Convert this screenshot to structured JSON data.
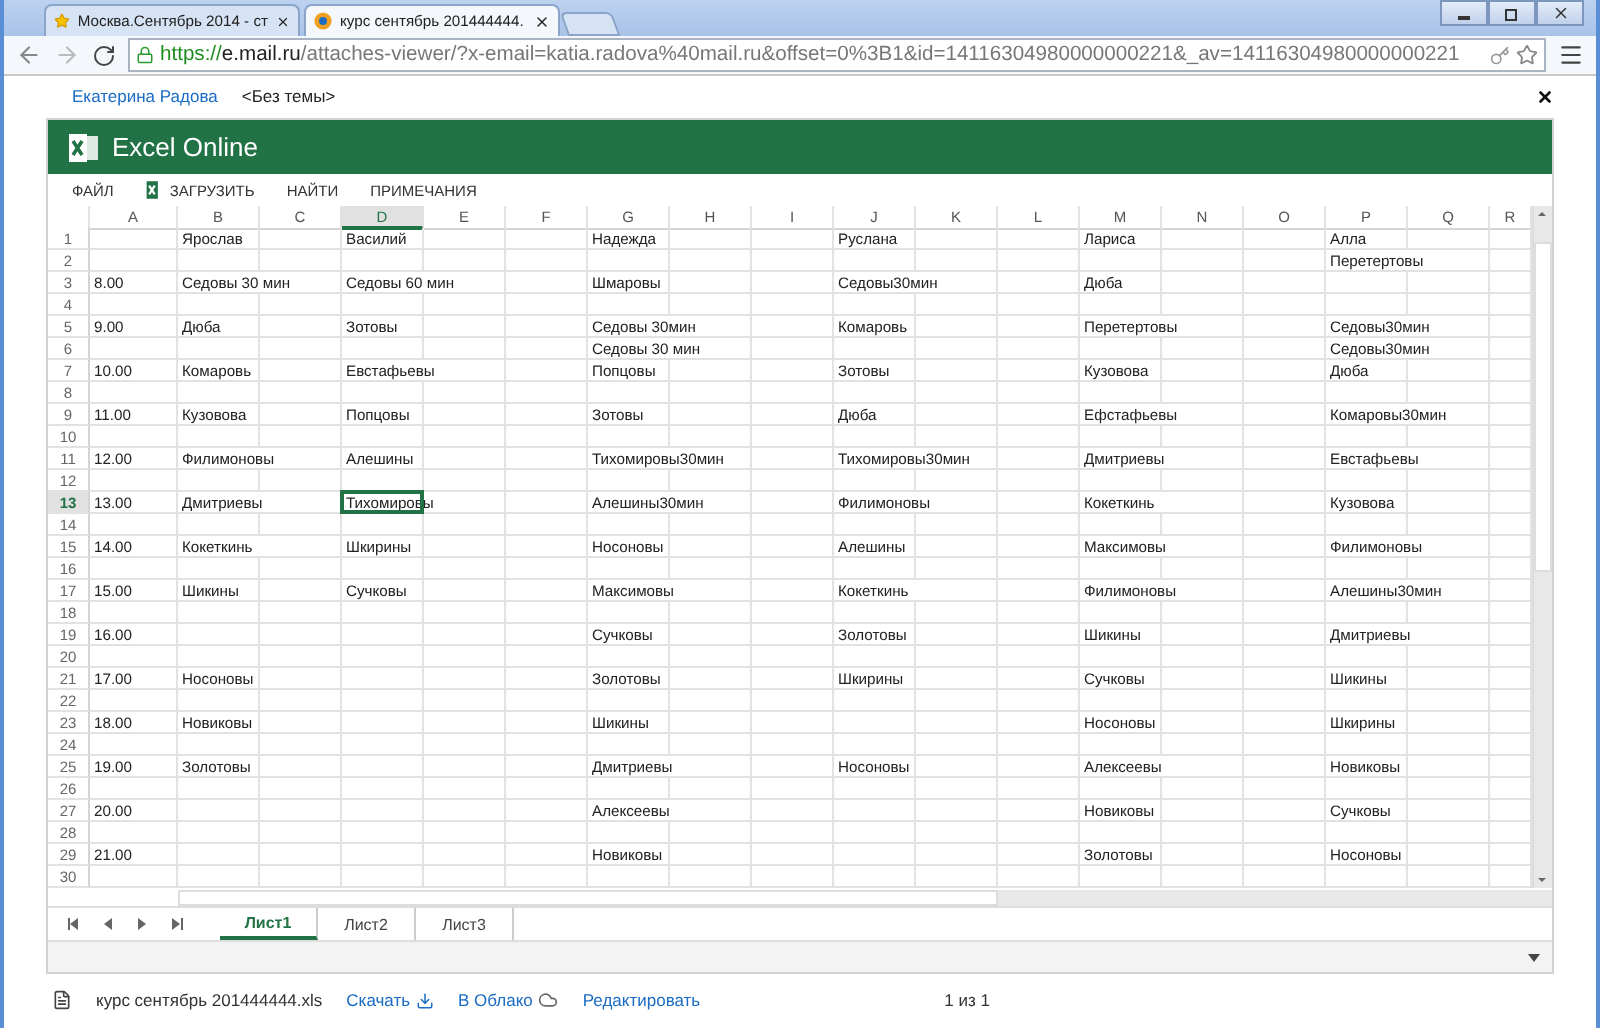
{
  "browser": {
    "tabs": [
      {
        "title": "Москва.Сентябрь 2014 - ст",
        "selected": false
      },
      {
        "title": "курс сентябрь 201444444.",
        "selected": true
      }
    ],
    "url": {
      "scheme": "https://",
      "host": "e.mail.ru",
      "path": "/attaches-viewer/?x-email=katia.radova%40mail.ru&offset=0%3B1&id=14116304980000000221&_av=14116304980000000221"
    }
  },
  "message": {
    "sender": "Екатерина Радова",
    "subject": "<Без темы>"
  },
  "app": {
    "title": "Excel Online",
    "menu": [
      {
        "label": "ФАЙЛ",
        "kind": "text"
      },
      {
        "label": "ЗАГРУЗИТЬ",
        "kind": "excel"
      },
      {
        "label": "НАЙТИ",
        "kind": "text"
      },
      {
        "label": "ПРИМЕЧАНИЯ",
        "kind": "text"
      }
    ]
  },
  "grid": {
    "columns": [
      {
        "label": "A",
        "selected": false
      },
      {
        "label": "B",
        "selected": false
      },
      {
        "label": "C",
        "selected": false
      },
      {
        "label": "D",
        "selected": true
      },
      {
        "label": "E",
        "selected": false
      },
      {
        "label": "F",
        "selected": false
      },
      {
        "label": "G",
        "selected": false
      },
      {
        "label": "H",
        "selected": false
      },
      {
        "label": "I",
        "selected": false
      },
      {
        "label": "J",
        "selected": false
      },
      {
        "label": "K",
        "selected": false
      },
      {
        "label": "L",
        "selected": false
      },
      {
        "label": "M",
        "selected": false
      },
      {
        "label": "N",
        "selected": false
      },
      {
        "label": "O",
        "selected": false
      },
      {
        "label": "P",
        "selected": false
      },
      {
        "label": "Q",
        "selected": false
      },
      {
        "label": "R",
        "selected": false
      }
    ],
    "rows": [
      {
        "number": "1",
        "selected": false,
        "cells": {
          "B": "Ярослав",
          "D": "Василий",
          "G": "Надежда",
          "J": "Руслана",
          "M": "Лариса",
          "P": "Алла"
        }
      },
      {
        "number": "2",
        "selected": false,
        "cells": {
          "P": "Перетертовы"
        }
      },
      {
        "number": "3",
        "selected": false,
        "cells": {
          "A": "8.00",
          "B": "Седовы 30 мин",
          "D": "Седовы 60 мин",
          "G": "Шмаровы",
          "J": "Седовы30мин",
          "M": "Дюба"
        }
      },
      {
        "number": "4",
        "selected": false,
        "cells": {}
      },
      {
        "number": "5",
        "selected": false,
        "cells": {
          "A": "9.00",
          "B": "Дюба",
          "D": "Зотовы",
          "G": "Седовы 30мин",
          "J": "Комаровь",
          "M": "Перетертовы",
          "P": "Седовы30мин"
        }
      },
      {
        "number": "6",
        "selected": false,
        "cells": {
          "G": "Седовы 30 мин",
          "P": "Седовы30мин"
        }
      },
      {
        "number": "7",
        "selected": false,
        "cells": {
          "A": "10.00",
          "B": "Комаровь",
          "D": "Евстафьевы",
          "G": "Попцовы",
          "J": "Зотовы",
          "M": "Кузовова",
          "P": "Дюба"
        }
      },
      {
        "number": "8",
        "selected": false,
        "cells": {}
      },
      {
        "number": "9",
        "selected": false,
        "cells": {
          "A": "11.00",
          "B": "Кузовова",
          "D": "Попцовы",
          "G": "Зотовы",
          "J": "Дюба",
          "M": "Ефстафьевы",
          "P": "Комаровы30мин"
        }
      },
      {
        "number": "10",
        "selected": false,
        "cells": {}
      },
      {
        "number": "11",
        "selected": false,
        "cells": {
          "A": "12.00",
          "B": "Филимоновы",
          "D": "Алешины",
          "G": "Тихомировы30мин",
          "J": "Тихомировы30мин",
          "M": "Дмитриевы",
          "P": "Евстафьевы"
        }
      },
      {
        "number": "12",
        "selected": false,
        "cells": {}
      },
      {
        "number": "13",
        "selected": true,
        "cells": {
          "A": "13.00",
          "B": "Дмитриевы",
          "D": "Тихомировы",
          "G": "Алешины30мин",
          "J": "Филимоновы",
          "M": "Кокеткинь",
          "P": "Кузовова"
        }
      },
      {
        "number": "14",
        "selected": false,
        "cells": {}
      },
      {
        "number": "15",
        "selected": false,
        "cells": {
          "A": "14.00",
          "B": "Кокеткинь",
          "D": "Шкирины",
          "G": "Носоновы",
          "J": "Алешины",
          "M": "Максимовы",
          "P": "Филимоновы"
        }
      },
      {
        "number": "16",
        "selected": false,
        "cells": {}
      },
      {
        "number": "17",
        "selected": false,
        "cells": {
          "A": "15.00",
          "B": "Шикины",
          "D": "Сучковы",
          "G": "Максимовы",
          "J": "Кокеткинь",
          "M": "Филимоновы",
          "P": "Алешины30мин"
        }
      },
      {
        "number": "18",
        "selected": false,
        "cells": {}
      },
      {
        "number": "19",
        "selected": false,
        "cells": {
          "A": "16.00",
          "G": "Сучковы",
          "J": "Золотовы",
          "M": "Шикины",
          "P": "Дмитриевы"
        }
      },
      {
        "number": "20",
        "selected": false,
        "cells": {}
      },
      {
        "number": "21",
        "selected": false,
        "cells": {
          "A": "17.00",
          "B": "Носоновы",
          "G": "Золотовы",
          "J": "Шкирины",
          "M": "Сучковы",
          "P": "Шикины"
        }
      },
      {
        "number": "22",
        "selected": false,
        "cells": {}
      },
      {
        "number": "23",
        "selected": false,
        "cells": {
          "A": "18.00",
          "B": "Новиковы",
          "G": "Шикины",
          "M": "Носоновы",
          "P": "Шкирины"
        }
      },
      {
        "number": "24",
        "selected": false,
        "cells": {}
      },
      {
        "number": "25",
        "selected": false,
        "cells": {
          "A": "19.00",
          "B": "Золотовы",
          "G": "Дмитриевы",
          "J": "Носоновы",
          "M": "Алексеевы",
          "P": "Новиковы"
        }
      },
      {
        "number": "26",
        "selected": false,
        "cells": {}
      },
      {
        "number": "27",
        "selected": false,
        "cells": {
          "A": "20.00",
          "G": "Алексеевы",
          "M": "Новиковы",
          "P": "Сучковы"
        }
      },
      {
        "number": "28",
        "selected": false,
        "cells": {}
      },
      {
        "number": "29",
        "selected": false,
        "cells": {
          "A": "21.00",
          "G": "Новиковы",
          "M": "Золотовы",
          "P": "Носоновы"
        }
      },
      {
        "number": "30",
        "selected": false,
        "cells": {}
      }
    ]
  },
  "sheets": [
    {
      "name": "Лист1",
      "selected": true
    },
    {
      "name": "Лист2",
      "selected": false
    },
    {
      "name": "Лист3",
      "selected": false
    }
  ],
  "footer": {
    "file": "курс сентябрь 201444444.xls",
    "actions": [
      {
        "label": "Скачать",
        "kind": "download"
      },
      {
        "label": "В Облако",
        "kind": "cloud"
      },
      {
        "label": "Редактировать",
        "kind": "text"
      }
    ],
    "pager": "1 из 1"
  }
}
